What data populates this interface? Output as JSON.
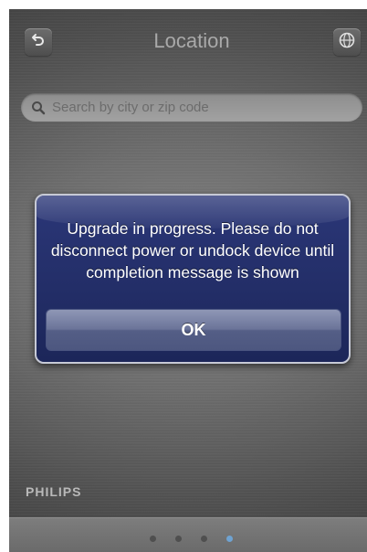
{
  "header": {
    "title": "Location",
    "back_icon": "back-arrow-icon",
    "globe_icon": "globe-icon"
  },
  "search": {
    "placeholder": "Search by city or zip code",
    "value": "",
    "icon": "search-icon"
  },
  "dialog": {
    "message": "Upgrade in progress. Please do not disconnect power or undock device until completion message is shown",
    "ok_label": "OK"
  },
  "brand": "PHILIPS",
  "pager": {
    "count": 4,
    "active_index": 3
  },
  "colors": {
    "dialog_bg": "#232e68",
    "ok_button": "#6b7499",
    "active_dot": "#6fa3d2"
  }
}
